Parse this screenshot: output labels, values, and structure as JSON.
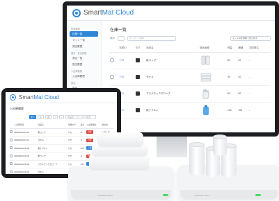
{
  "brand": {
    "name_pre": "Smart",
    "name_accent": "Mat Cloud",
    "accent_color": "#2f86d6",
    "bezel_color": "#1b1d20"
  },
  "monitor": {
    "sidebar": [
      {
        "kind": "head",
        "label": "在庫管理"
      },
      {
        "kind": "item",
        "label": "在庫一覧",
        "active": true
      },
      {
        "kind": "item",
        "label": "マット一覧",
        "active": false
      },
      {
        "kind": "item",
        "label": "発注履歴",
        "active": false
      },
      {
        "kind": "head",
        "label": "発注・受注管理"
      },
      {
        "kind": "item",
        "label": "発注一覧",
        "active": false
      },
      {
        "kind": "item",
        "label": "受注履歴",
        "active": false
      },
      {
        "kind": "head",
        "label": "入出庫管理"
      },
      {
        "kind": "item",
        "label": "入出庫履歴",
        "active": false
      },
      {
        "kind": "head",
        "label": "設定"
      },
      {
        "kind": "item",
        "label": "商品",
        "active": false
      },
      {
        "kind": "item",
        "label": "拠点",
        "active": false
      }
    ],
    "title": "在庫一覧",
    "toolbar": {
      "label": "表示",
      "search_placeholder": "キーワード検索",
      "select_value": "マットIDを昇順で並び替え"
    },
    "columns": [
      "",
      "在庫ID",
      "タグ",
      "商品名",
      "商品画像",
      "残量",
      "閾値",
      "次回発注"
    ],
    "rows": [
      {
        "id": "ｱｲｳｴ",
        "tag": "",
        "name": "紙コップ",
        "image": "cups",
        "remain": "60",
        "threshold": "40",
        "next": "-"
      },
      {
        "id": "ｱｲｳｴ",
        "tag": "",
        "name": "タオル",
        "image": "towels",
        "remain": "40",
        "threshold": "20",
        "next": "-"
      },
      {
        "id": "ｱｲｳｴ",
        "tag": "",
        "name": "プラスチックグローブ",
        "image": "gloves",
        "remain": "80",
        "threshold": "50",
        "next": "-"
      },
      {
        "id": "ｱｲｳｴ",
        "tag": "",
        "name": "紙ナプキン",
        "image": "bottle",
        "remain": "120",
        "threshold": "100",
        "next": "-"
      }
    ]
  },
  "tablet": {
    "title": "入出庫履歴",
    "chips": [
      "全て",
      "入",
      "出"
    ],
    "chips_extra": [
      "‹",
      "›"
    ],
    "search_placeholder": "商品名・マットIDで検索",
    "columns": [
      "",
      "入出庫時間",
      "商品名",
      "残量タグ",
      "差分",
      "入出庫種別",
      "担当者"
    ],
    "rows": [
      {
        "time": "2023/04/01 10:23",
        "name": "紙コップ",
        "tag": "ｱｲｳｴ",
        "diff": "-5",
        "type": "出庫",
        "type_color": "red",
        "user": "山田太郎"
      },
      {
        "time": "2023/04/01 10:11",
        "name": "タオル",
        "tag": "ｱｲｳｴ",
        "diff": "-3",
        "type": "出庫",
        "type_color": "red",
        "user": "山田太郎"
      },
      {
        "time": "2023/04/01 09:58",
        "name": "紙ナプキン",
        "tag": "ｱｲｳｴ",
        "diff": "+20",
        "type": "入庫",
        "type_color": "blue",
        "user": "鈴木花子"
      },
      {
        "time": "2023/04/01 09:40",
        "name": "紙コップ",
        "tag": "ｱｲｳｴ",
        "diff": "-2",
        "type": "出庫",
        "type_color": "red",
        "user": "山田太郎"
      },
      {
        "time": "2023/04/01 09:32",
        "name": "プラスチックグローブ",
        "tag": "ｱｲｳｴ",
        "diff": "+40",
        "type": "入庫",
        "type_color": "blue",
        "user": "鈴木花子"
      },
      {
        "time": "2023/04/01 09:20",
        "name": "タオル",
        "tag": "ｱｲｳｴ",
        "diff": "+10",
        "type": "入庫",
        "type_color": "blue",
        "user": "鈴木花子"
      }
    ]
  },
  "scales": {
    "label": "SmartMat Cloud",
    "led_color": "#4cd964"
  }
}
